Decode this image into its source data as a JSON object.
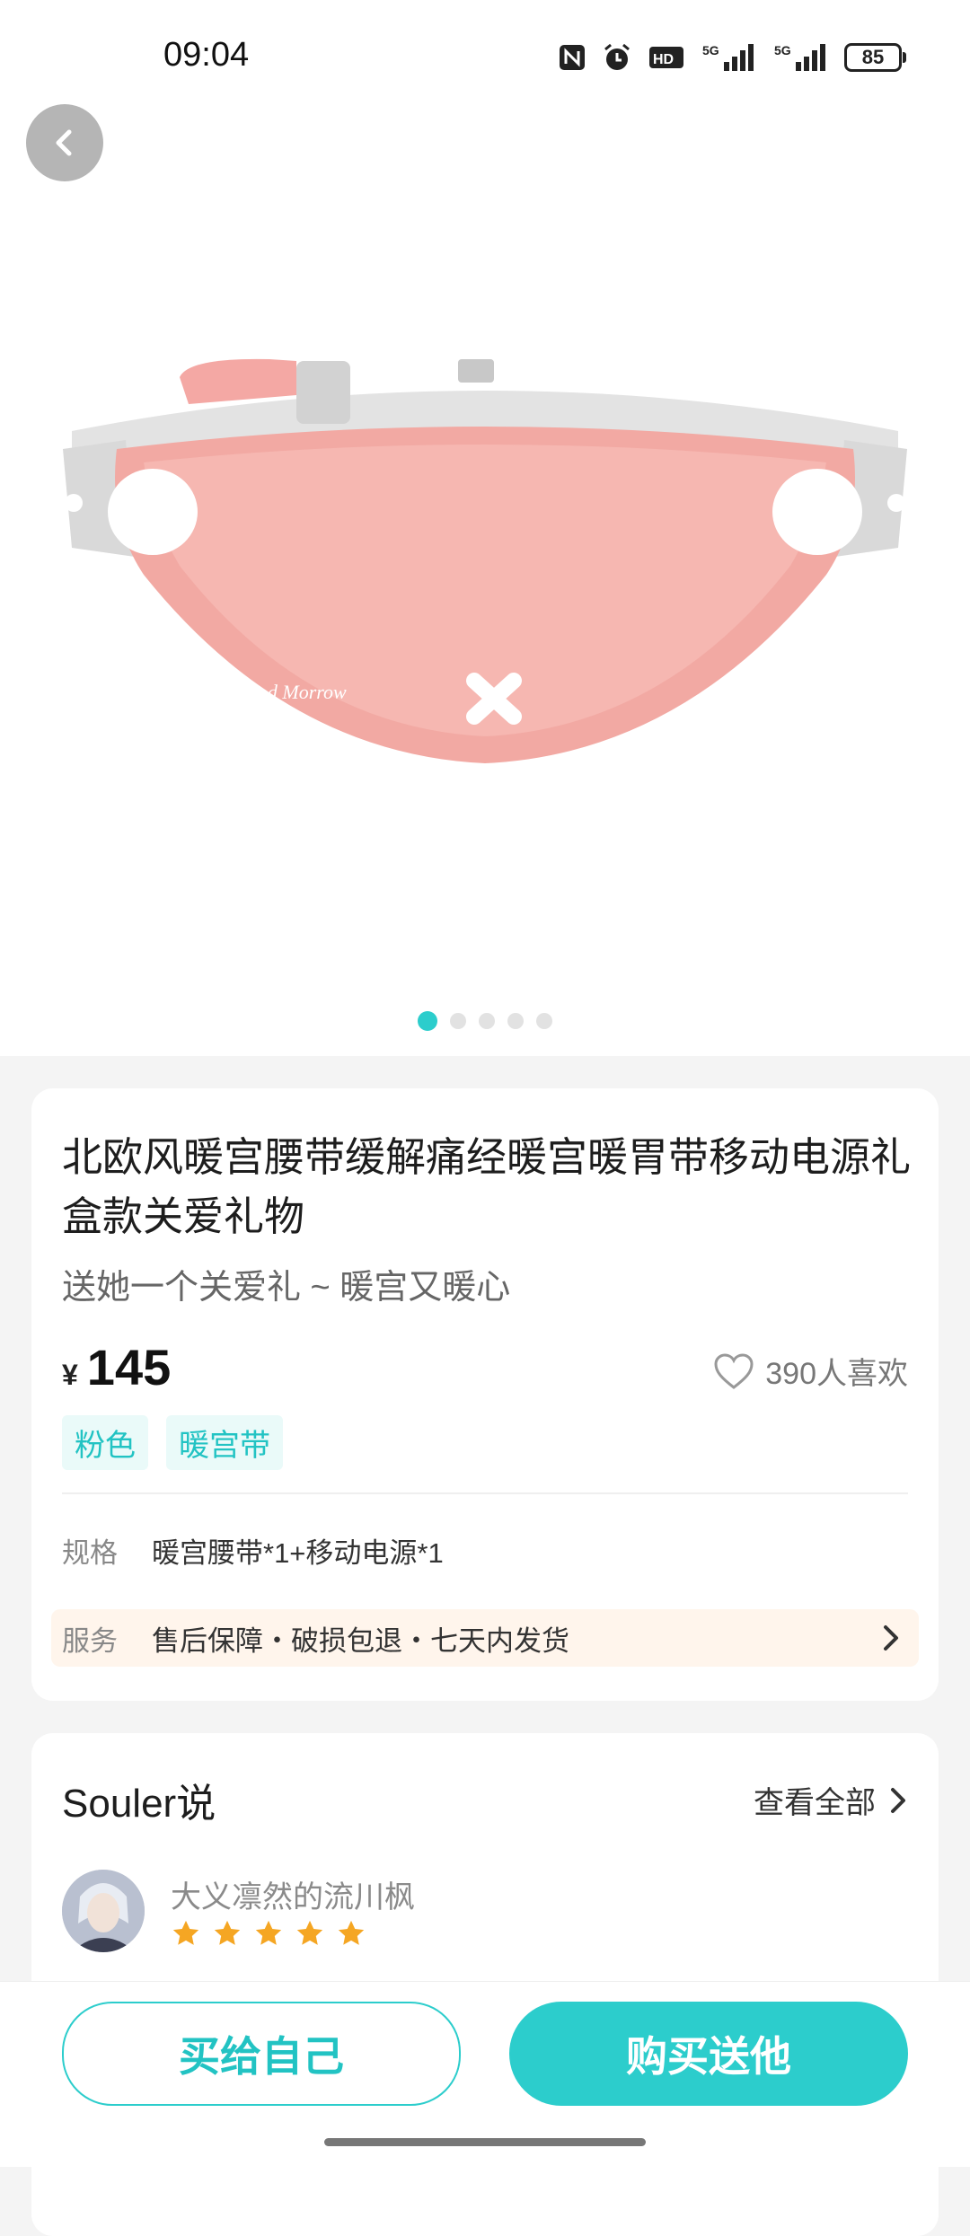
{
  "status_bar": {
    "time": "09:04",
    "battery": "85",
    "icons": [
      "nfc-icon",
      "alarm-icon",
      "hd-icon",
      "signal-5g-icon",
      "signal-5g-icon"
    ]
  },
  "gallery": {
    "image_count": 5,
    "active_index": 0,
    "product_print": "Good Morrow"
  },
  "product": {
    "title": "北欧风暖宫腰带缓解痛经暖宫暖胃带移动电源礼盒款关爱礼物",
    "subtitle": "送她一个关爱礼 ~ 暖宫又暖心",
    "currency": "¥",
    "price": "145",
    "likes": "390人喜欢",
    "tags": [
      "粉色",
      "暖宫带"
    ],
    "spec_label": "规格",
    "spec_value": "暖宫腰带*1+移动电源*1",
    "service_label": "服务",
    "service_value": "售后保障・破损包退・七天内发货"
  },
  "reviews": {
    "title": "Souler说",
    "see_all": "查看全部",
    "reviewer": "大义凛然的流川枫",
    "rating": 5
  },
  "actions": {
    "buy_self": "买给自己",
    "buy_gift": "购买送他"
  },
  "colors": {
    "accent": "#2ccdcc",
    "product_pink": "#f2a9a3",
    "service_bg": "#fff5ec",
    "star": "#f5a623"
  }
}
